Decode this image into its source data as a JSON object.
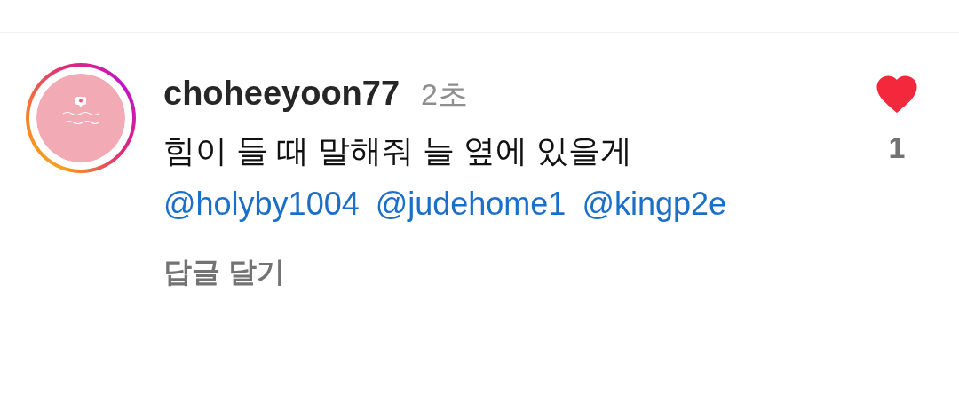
{
  "comment": {
    "username": "choheeyoon77",
    "time": "2초",
    "text": "힘이 들 때 말해줘 늘 옆에 있을게",
    "mentions": [
      "@holyby1004",
      "@judehome1",
      "@kingp2e"
    ],
    "reply_label": "답글 달기",
    "liked": true,
    "like_count": "1",
    "has_story": true
  }
}
